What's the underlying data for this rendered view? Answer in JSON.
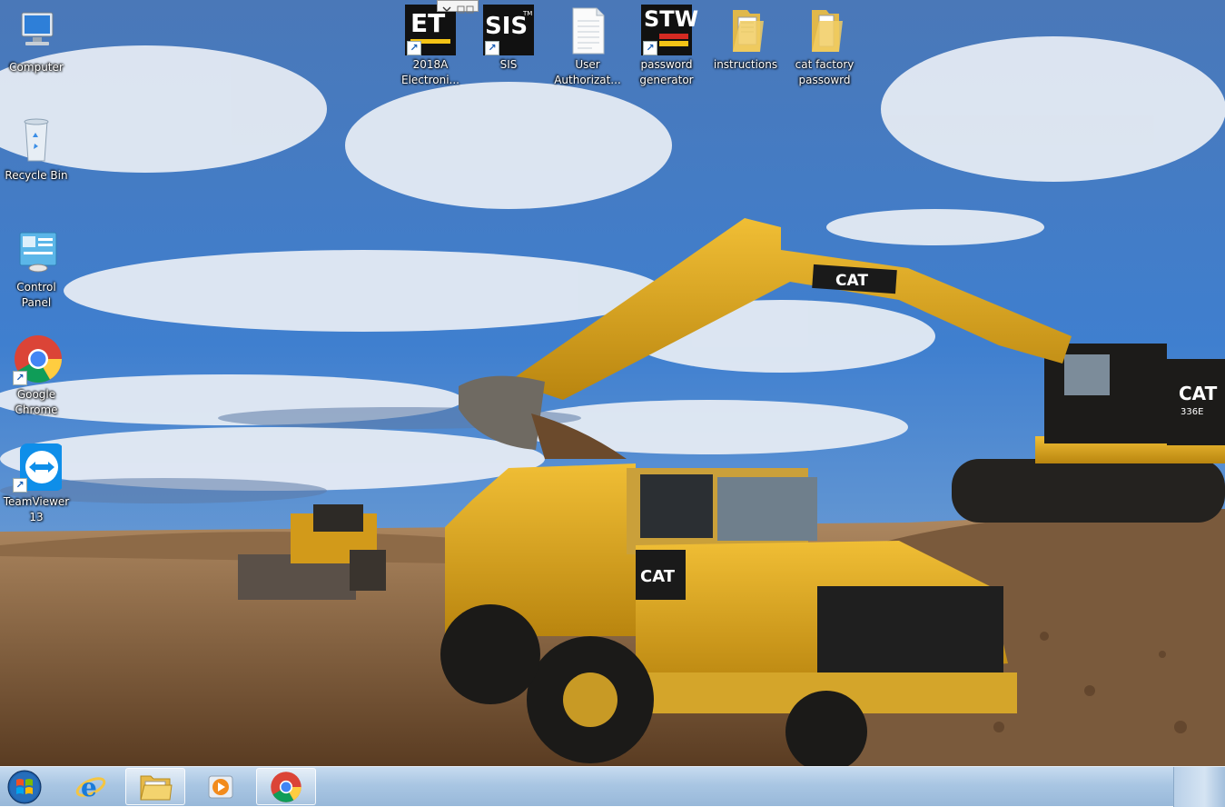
{
  "wallpaper": {
    "machine_brand_boom": "CAT",
    "machine_brand_cab": "CAT",
    "excavator_model": "336E",
    "truck_brand": "CAT"
  },
  "desktop_icons": [
    {
      "label": "Computer",
      "icon": "computer-icon"
    },
    {
      "label": "Recycle Bin",
      "icon": "recycle-bin-icon"
    },
    {
      "label": "Control\nPanel",
      "icon": "control-panel-icon"
    },
    {
      "label": "Google\nChrome",
      "icon": "chrome-icon"
    },
    {
      "label": "TeamViewer\n13",
      "icon": "teamviewer-icon"
    },
    {
      "label": "2018A\nElectroni...",
      "icon": "et-icon",
      "glyph_text": "ET"
    },
    {
      "label": "SIS",
      "icon": "sis-icon",
      "glyph_text": "SIS",
      "glyph_sup": "TM"
    },
    {
      "label": "User\nAuthorizat...",
      "icon": "text-document-icon"
    },
    {
      "label": "password\ngenerator",
      "icon": "stw-icon",
      "glyph_text": "STW"
    },
    {
      "label": "instructions",
      "icon": "folder-icon"
    },
    {
      "label": "cat factory\npassowrd",
      "icon": "folder-icon"
    }
  ],
  "taskbar": {
    "items": [
      {
        "name": "start",
        "icon": "windows-start-icon"
      },
      {
        "name": "internet-explorer",
        "icon": "internet-explorer-icon"
      },
      {
        "name": "file-explorer",
        "icon": "folder-icon",
        "active": true
      },
      {
        "name": "media-player",
        "icon": "media-player-icon"
      },
      {
        "name": "chrome",
        "icon": "chrome-icon",
        "active": true
      }
    ]
  },
  "colors": {
    "sky": "#3f76c4",
    "dirt": "#a07a52",
    "cat_yellow": "#e2a81a",
    "taskbar": "#a9c6e3"
  }
}
